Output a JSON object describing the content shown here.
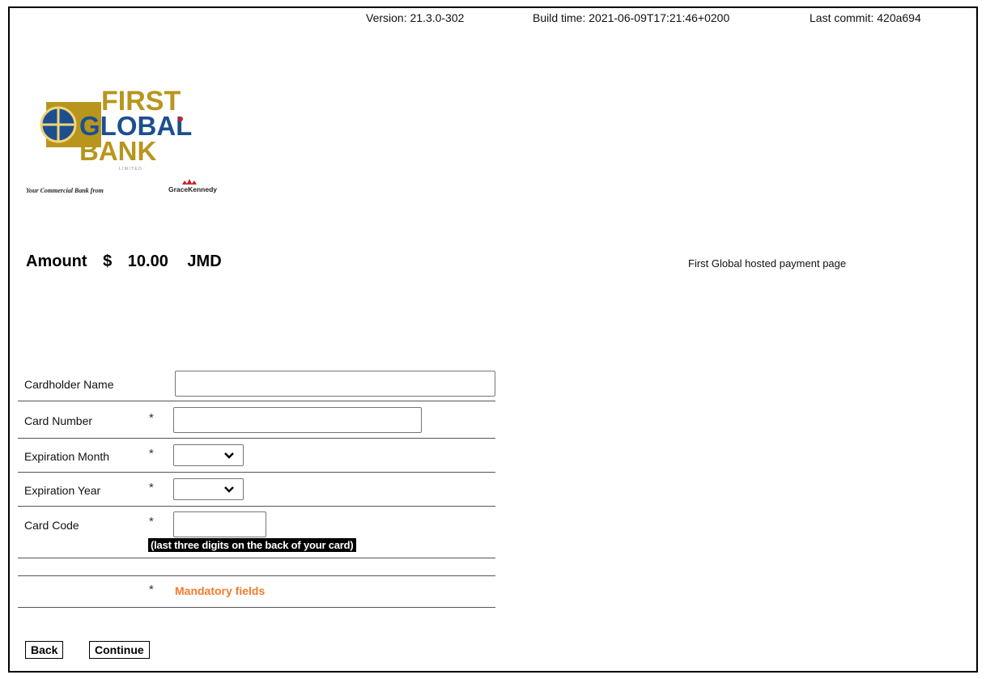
{
  "header": {
    "version": "Version: 21.3.0-302",
    "build_time": "Build time: 2021-06-09T17:21:46+0200",
    "last_commit": "Last commit: 420a694"
  },
  "logo": {
    "line1": "FIRST",
    "line2": "GLOBAL",
    "line3": "BANK",
    "limited": "L I M I T E D",
    "tagline": "Your Commercial Bank from",
    "tagline_brand": "GraceKennedy",
    "colors": {
      "gold": "#b8961e",
      "blue": "#1d4f8f",
      "red": "#c9232d"
    }
  },
  "amount": {
    "label": "Amount",
    "currency_symbol": "$",
    "value": "10.00",
    "currency": "JMD"
  },
  "hosted_note": "First Global hosted payment page",
  "form": {
    "cardholder_name": {
      "label": "Cardholder Name",
      "value": ""
    },
    "card_number": {
      "label": "Card Number",
      "required_mark": "*",
      "value": ""
    },
    "expiration_month": {
      "label": "Expiration Month",
      "required_mark": "*",
      "selected": ""
    },
    "expiration_year": {
      "label": "Expiration Year",
      "required_mark": "*",
      "selected": ""
    },
    "card_code": {
      "label": "Card Code",
      "required_mark": "*",
      "value": "",
      "hint": "(last three digits on the back of your card)"
    },
    "mandatory": {
      "mark": "*",
      "text": "Mandatory fields",
      "color": "#f47a2c"
    }
  },
  "buttons": {
    "back": "Back",
    "continue": "Continue"
  }
}
